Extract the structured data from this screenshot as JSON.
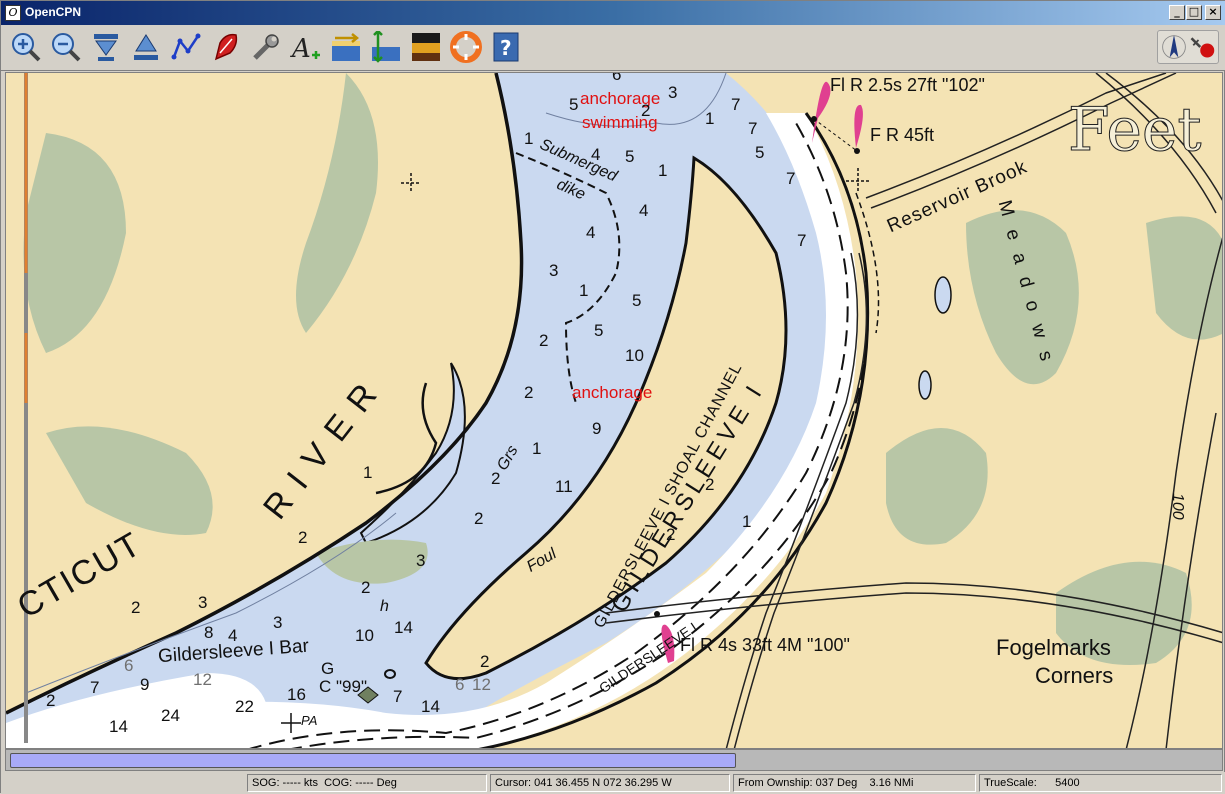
{
  "window": {
    "title": "OpenCPN",
    "app_icon": "opencpn-logo-icon",
    "controls": [
      "_",
      "□",
      "×"
    ]
  },
  "toolbar": {
    "buttons": [
      {
        "icon": "zoom-in-icon"
      },
      {
        "icon": "zoom-out-icon"
      },
      {
        "icon": "scale-down-icon"
      },
      {
        "icon": "scale-up-icon"
      },
      {
        "icon": "route-icon"
      },
      {
        "icon": "follow-ship-icon"
      },
      {
        "icon": "settings-icon"
      },
      {
        "icon": "text-add-icon"
      },
      {
        "icon": "current-tide-icon"
      },
      {
        "icon": "tide-station-icon"
      },
      {
        "icon": "color-scheme-icon"
      },
      {
        "icon": "mob-icon"
      },
      {
        "icon": "help-icon"
      }
    ],
    "right_icons": [
      "north-up-icon",
      "gps-status-icon"
    ]
  },
  "chart": {
    "watermark": "Feet",
    "river_name": [
      "CTICUT",
      "RIVER"
    ],
    "island_name": "GILDERSLEEVE I",
    "channel_name": "GILDERSLEEVE I SHOAL CHANNEL",
    "channel_name_2": "GILDERSLEEVE I",
    "bar_name": "Gildersleeve I Bar",
    "brook_name": "Reservoir Brook",
    "meadows": "Meadows",
    "corners": [
      "Fogelmarks",
      "Corners"
    ],
    "notes": {
      "anchorage_swimming": [
        "anchorage",
        "swimming"
      ],
      "anchorage": "anchorage",
      "submerged_dike": [
        "Submerged",
        "dike"
      ],
      "foul": "Foul",
      "grs": "Grs",
      "pa": "PA",
      "h": "h",
      "contour_100": "100"
    },
    "lights": {
      "light_102": "Fl R 2.5s 27ft \"102\"",
      "light_45": "F R 45ft",
      "light_100": "Fl R 4s 33ft 4M \"100\"",
      "buoy_99": "C \"99\"",
      "buoy_g": "G"
    },
    "depths": [
      "6",
      "5",
      "2",
      "3",
      "7",
      "1",
      "7",
      "4",
      "5",
      "1",
      "5",
      "7",
      "1",
      "4",
      "4",
      "7",
      "3",
      "1",
      "5",
      "2",
      "5",
      "10",
      "2",
      "1",
      "9",
      "2",
      "11",
      "2",
      "2",
      "2",
      "1",
      "2",
      "3",
      "3",
      "2",
      "8",
      "4",
      "3",
      "10",
      "14",
      "6",
      "9",
      "12",
      "2",
      "7",
      "16",
      "22",
      "24",
      "14",
      "7",
      "6",
      "12",
      "14",
      "2",
      "1",
      "2"
    ]
  },
  "status": {
    "sog": "SOG: ----- kts  COG: ----- Deg",
    "cursor": "Cursor: 041 36.455 N 072 36.295 W",
    "ownship": "From Ownship: 037 Deg    3.16 NMi",
    "scale": "TrueScale:      5400"
  }
}
